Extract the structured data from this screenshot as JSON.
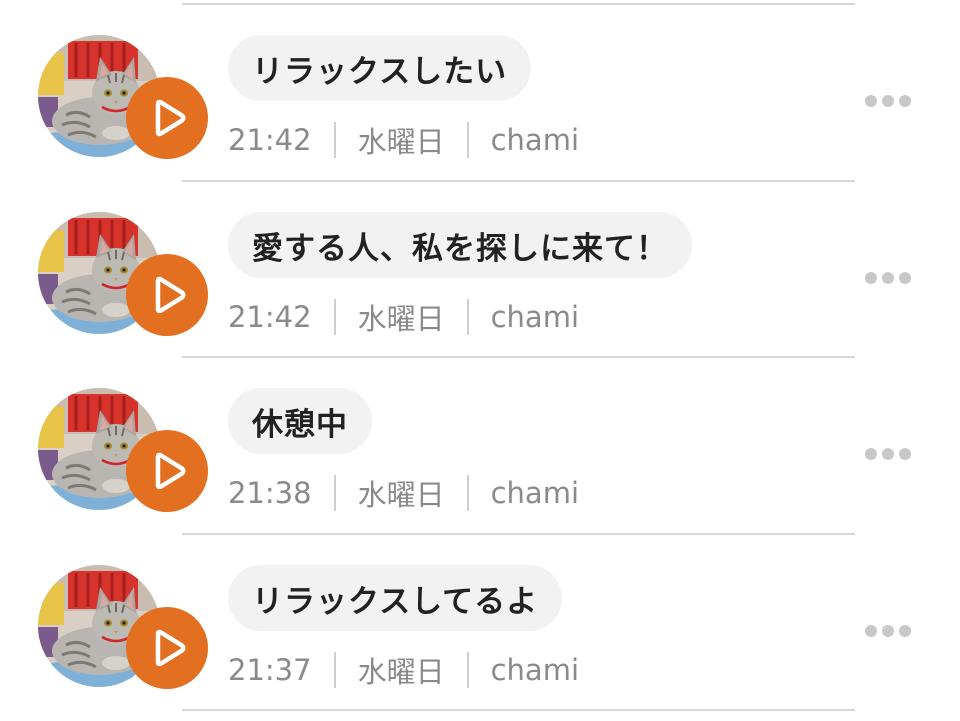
{
  "accent_color": "#e36f21",
  "play_icon": "play-icon",
  "more_icon": "more-dots-icon",
  "messages": [
    {
      "text": "リラックスしたい",
      "time": "21:42",
      "day": "水曜日",
      "user": "chami"
    },
    {
      "text": "愛する人、私を探しに来て！",
      "time": "21:42",
      "day": "水曜日",
      "user": "chami"
    },
    {
      "text": "休憩中",
      "time": "21:38",
      "day": "水曜日",
      "user": "chami"
    },
    {
      "text": "リラックスしてるよ",
      "time": "21:37",
      "day": "水曜日",
      "user": "chami"
    }
  ]
}
